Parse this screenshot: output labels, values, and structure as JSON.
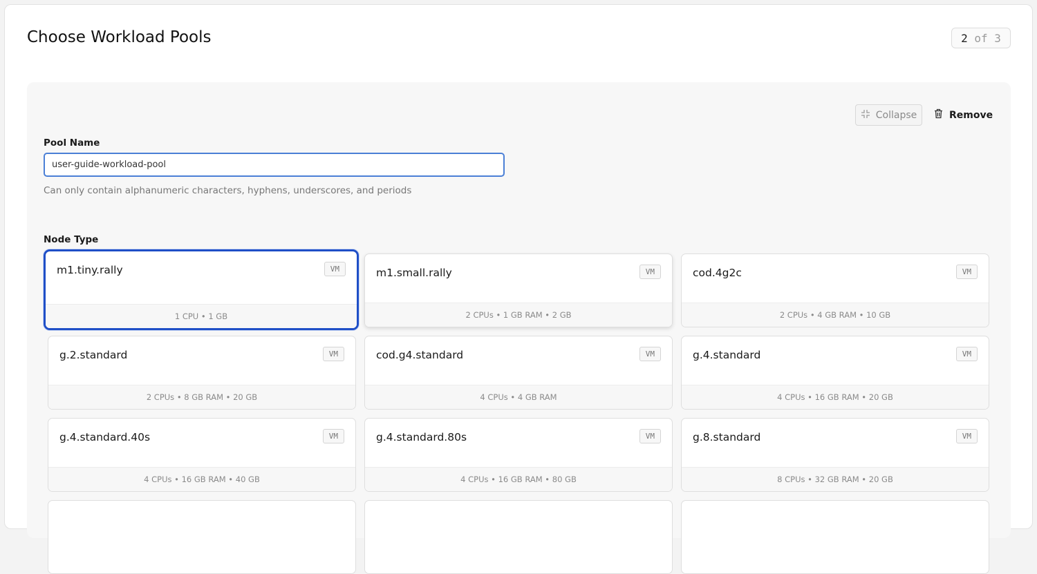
{
  "page": {
    "title": "Choose Workload Pools"
  },
  "stepper": {
    "current": "2",
    "rest": " of 3"
  },
  "pool": {
    "collapse_label": "Collapse",
    "remove_label": "Remove",
    "name_label": "Pool Name",
    "name_value": "user-guide-workload-pool",
    "name_hint": "Can only contain alphanumeric characters, hyphens, underscores, and periods",
    "node_type_label": "Node Type"
  },
  "node_types": [
    {
      "name": "m1.tiny.rally",
      "kind": "VM",
      "spec": "1 CPU • 1 GB",
      "state": "selected"
    },
    {
      "name": "m1.small.rally",
      "kind": "VM",
      "spec": "2 CPUs • 1 GB RAM • 2 GB",
      "state": "hovered"
    },
    {
      "name": "cod.4g2c",
      "kind": "VM",
      "spec": "2 CPUs • 4 GB RAM • 10 GB",
      "state": ""
    },
    {
      "name": "g.2.standard",
      "kind": "VM",
      "spec": "2 CPUs • 8 GB RAM • 20 GB",
      "state": ""
    },
    {
      "name": "cod.g4.standard",
      "kind": "VM",
      "spec": "4 CPUs • 4 GB RAM",
      "state": ""
    },
    {
      "name": "g.4.standard",
      "kind": "VM",
      "spec": "4 CPUs • 16 GB RAM • 20 GB",
      "state": ""
    },
    {
      "name": "g.4.standard.40s",
      "kind": "VM",
      "spec": "4 CPUs • 16 GB RAM • 40 GB",
      "state": ""
    },
    {
      "name": "g.4.standard.80s",
      "kind": "VM",
      "spec": "4 CPUs • 16 GB RAM • 80 GB",
      "state": ""
    },
    {
      "name": "g.8.standard",
      "kind": "VM",
      "spec": "8 CPUs • 32 GB RAM • 20 GB",
      "state": ""
    },
    {
      "name": "",
      "kind": "",
      "spec": "",
      "state": ""
    },
    {
      "name": "",
      "kind": "",
      "spec": "",
      "state": ""
    },
    {
      "name": "",
      "kind": "",
      "spec": "",
      "state": ""
    }
  ],
  "icons": {
    "collapse": "collapse-arrows-icon",
    "remove": "trash-icon"
  },
  "colors": {
    "selected_border": "#1f4fc7",
    "input_focus": "#4a7fd6"
  }
}
